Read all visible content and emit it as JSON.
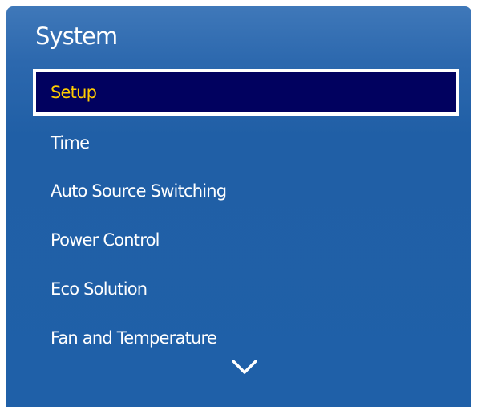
{
  "menu": {
    "title": "System",
    "items": [
      {
        "label": "Setup",
        "selected": true
      },
      {
        "label": "Time",
        "selected": false
      },
      {
        "label": "Auto Source Switching",
        "selected": false
      },
      {
        "label": "Power Control",
        "selected": false
      },
      {
        "label": "Eco Solution",
        "selected": false
      },
      {
        "label": "Fan and Temperature",
        "selected": false
      }
    ],
    "scroll_icon": "chevron-down-icon"
  },
  "colors": {
    "panel_background": "#2062aa",
    "selected_background": "#01015f",
    "selected_border": "#ffffff",
    "selected_text": "#ffcc00",
    "item_text": "#ffffff"
  }
}
